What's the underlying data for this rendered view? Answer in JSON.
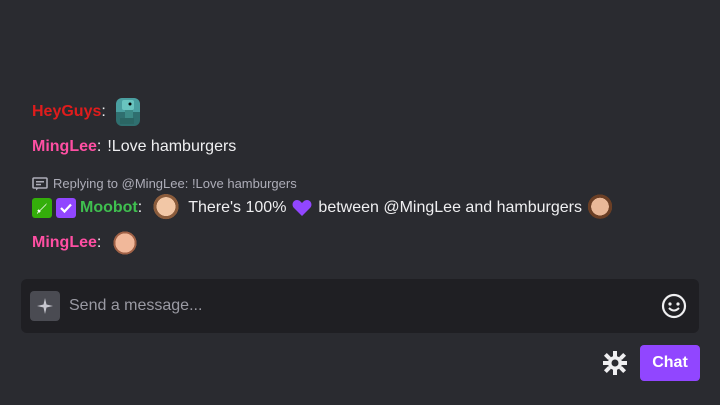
{
  "chat": {
    "messages": [
      {
        "user": "HeyGuys",
        "user_color": "#e01c1c",
        "emotes": [
          "dino-emote"
        ]
      },
      {
        "user": "MingLee",
        "user_color": "#ff4fa3",
        "text": "!Love hamburgers"
      },
      {
        "reply": "Replying to @MingLee: !Love hamburgers"
      },
      {
        "user": "Moobot",
        "user_color": "#3fbf4f",
        "text_before": "There's 100%",
        "text_after": "between @MingLee and hamburgers"
      },
      {
        "user": "MingLee",
        "user_color": "#ff4fa3"
      }
    ]
  },
  "composer": {
    "placeholder": "Send a message...",
    "send_label": "Chat"
  },
  "colors": {
    "accent": "#9146ff",
    "background": "#2a2b30",
    "input_bg": "#1f1f23"
  },
  "icons": {
    "sparkle": "sparkle-icon",
    "emoji": "smiley-icon",
    "settings": "gear-icon",
    "reply": "reply-icon"
  }
}
